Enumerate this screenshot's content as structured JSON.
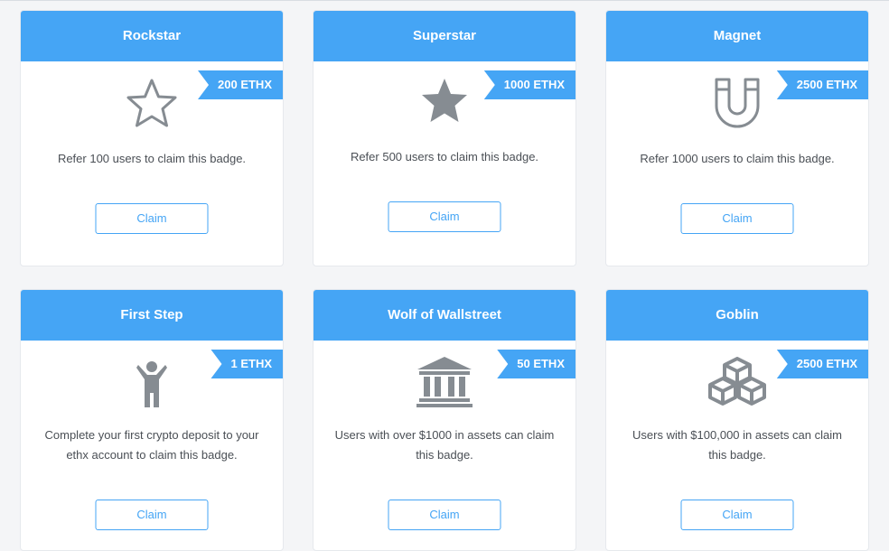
{
  "badges": [
    {
      "title": "Rockstar",
      "reward": "200 ETHX",
      "icon": "star-outline-icon",
      "description": "Refer 100 users to claim this badge.",
      "button": "Claim"
    },
    {
      "title": "Superstar",
      "reward": "1000 ETHX",
      "icon": "star-filled-icon",
      "description": "Refer 500 users to claim this badge.",
      "button": "Claim"
    },
    {
      "title": "Magnet",
      "reward": "2500 ETHX",
      "icon": "magnet-icon",
      "description": "Refer 1000 users to claim this badge.",
      "button": "Claim"
    },
    {
      "title": "First Step",
      "reward": "1 ETHX",
      "icon": "person-arms-up-icon",
      "description": "Complete your first crypto deposit to your ethx account to claim this badge.",
      "button": "Claim"
    },
    {
      "title": "Wolf of Wallstreet",
      "reward": "50 ETHX",
      "icon": "bank-icon",
      "description": "Users with over $1000 in assets can claim this badge.",
      "button": "Claim"
    },
    {
      "title": "Goblin",
      "reward": "2500 ETHX",
      "icon": "cubes-icon",
      "description": "Users with $100,000 in assets can claim this badge.",
      "button": "Claim"
    }
  ],
  "colors": {
    "accent": "#45a5f5",
    "icon_gray": "#868c92",
    "text": "#4a4f55"
  }
}
